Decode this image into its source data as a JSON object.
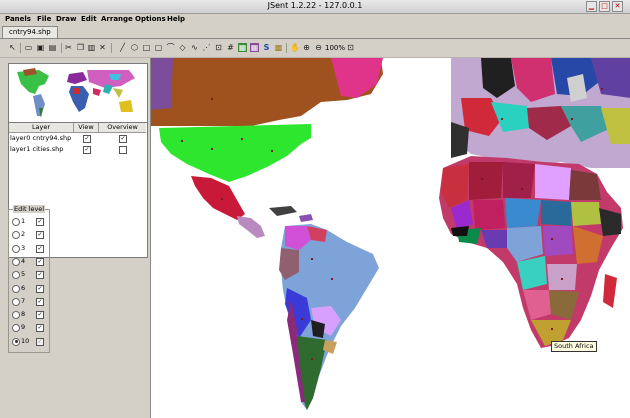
{
  "window": {
    "title": "JSent 1.2.22 - 127.0.0.1"
  },
  "menu": [
    "Panels",
    "File",
    "Draw",
    "Edit",
    "Arrange",
    "Options",
    "Help"
  ],
  "tab": {
    "label": "cntry94.shp"
  },
  "toolbar": {
    "zoom_label": "100%"
  },
  "layers": {
    "headers": [
      "Layer",
      "View",
      "Overview"
    ],
    "rows": [
      {
        "name": "layer0 cntry94.shp",
        "view": true,
        "overview": true
      },
      {
        "name": "layer1 cities.shp",
        "view": true,
        "overview": false
      }
    ]
  },
  "edit_level": {
    "title": "Edit level",
    "levels": [
      "1",
      "2",
      "3",
      "4",
      "5",
      "6",
      "7",
      "8",
      "9",
      "10"
    ],
    "selected": "10"
  },
  "map": {
    "tooltip": "South Africa"
  }
}
